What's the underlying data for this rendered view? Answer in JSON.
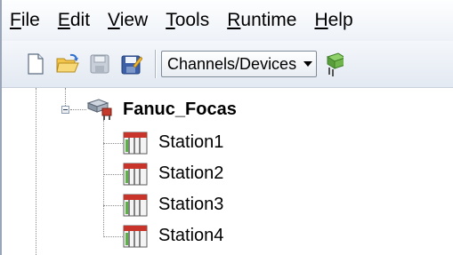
{
  "menu": {
    "items": [
      {
        "accel": "F",
        "rest": "ile"
      },
      {
        "accel": "E",
        "rest": "dit"
      },
      {
        "accel": "V",
        "rest": "iew"
      },
      {
        "accel": "T",
        "rest": "ools"
      },
      {
        "accel": "R",
        "rest": "untime"
      },
      {
        "accel": "H",
        "rest": "elp"
      }
    ]
  },
  "toolbar": {
    "view_select_value": "Channels/Devices"
  },
  "tree": {
    "channel": {
      "label": "Fanuc_Focas"
    },
    "devices": [
      {
        "label": "Station1"
      },
      {
        "label": "Station2"
      },
      {
        "label": "Station3"
      },
      {
        "label": "Station4"
      }
    ]
  },
  "icons": {
    "new": "new-file-icon",
    "open": "open-folder-icon",
    "save": "save-icon",
    "save_as": "save-as-icon",
    "channel": "channel-icon",
    "device": "device-icon"
  }
}
